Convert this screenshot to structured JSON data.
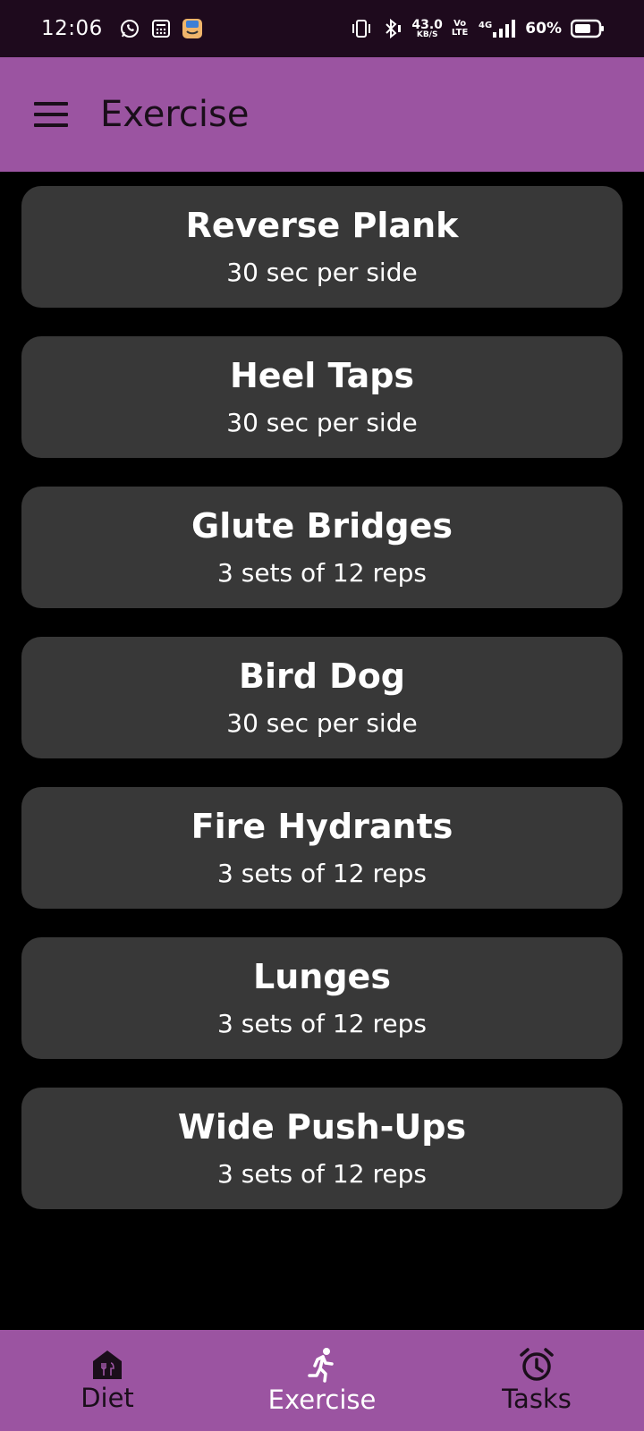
{
  "status_bar": {
    "time": "12:06",
    "net_speed_value": "43.0",
    "net_speed_unit": "KB/S",
    "volte_top": "Vo",
    "volte_bottom": "LTE",
    "network": "4G",
    "battery": "60%"
  },
  "app_bar": {
    "title": "Exercise"
  },
  "exercises": [
    {
      "name": "Reverse Plank",
      "detail": "30 sec per side"
    },
    {
      "name": "Heel Taps",
      "detail": "30 sec per side"
    },
    {
      "name": "Glute Bridges",
      "detail": "3 sets of 12 reps"
    },
    {
      "name": "Bird Dog",
      "detail": "30 sec per side"
    },
    {
      "name": "Fire Hydrants",
      "detail": "3 sets of 12 reps"
    },
    {
      "name": "Lunges",
      "detail": "3 sets of 12 reps"
    },
    {
      "name": "Wide Push-Ups",
      "detail": "3 sets of 12 reps"
    }
  ],
  "bottom_nav": {
    "items": [
      {
        "label": "Diet",
        "icon": "diet-icon",
        "active": false
      },
      {
        "label": "Exercise",
        "icon": "run-icon",
        "active": true
      },
      {
        "label": "Tasks",
        "icon": "alarm-icon",
        "active": false
      }
    ]
  },
  "colors": {
    "status_bar_bg": "#1e0a1d",
    "accent": "#9b54a1",
    "card_bg": "#383838",
    "background": "#000000"
  }
}
